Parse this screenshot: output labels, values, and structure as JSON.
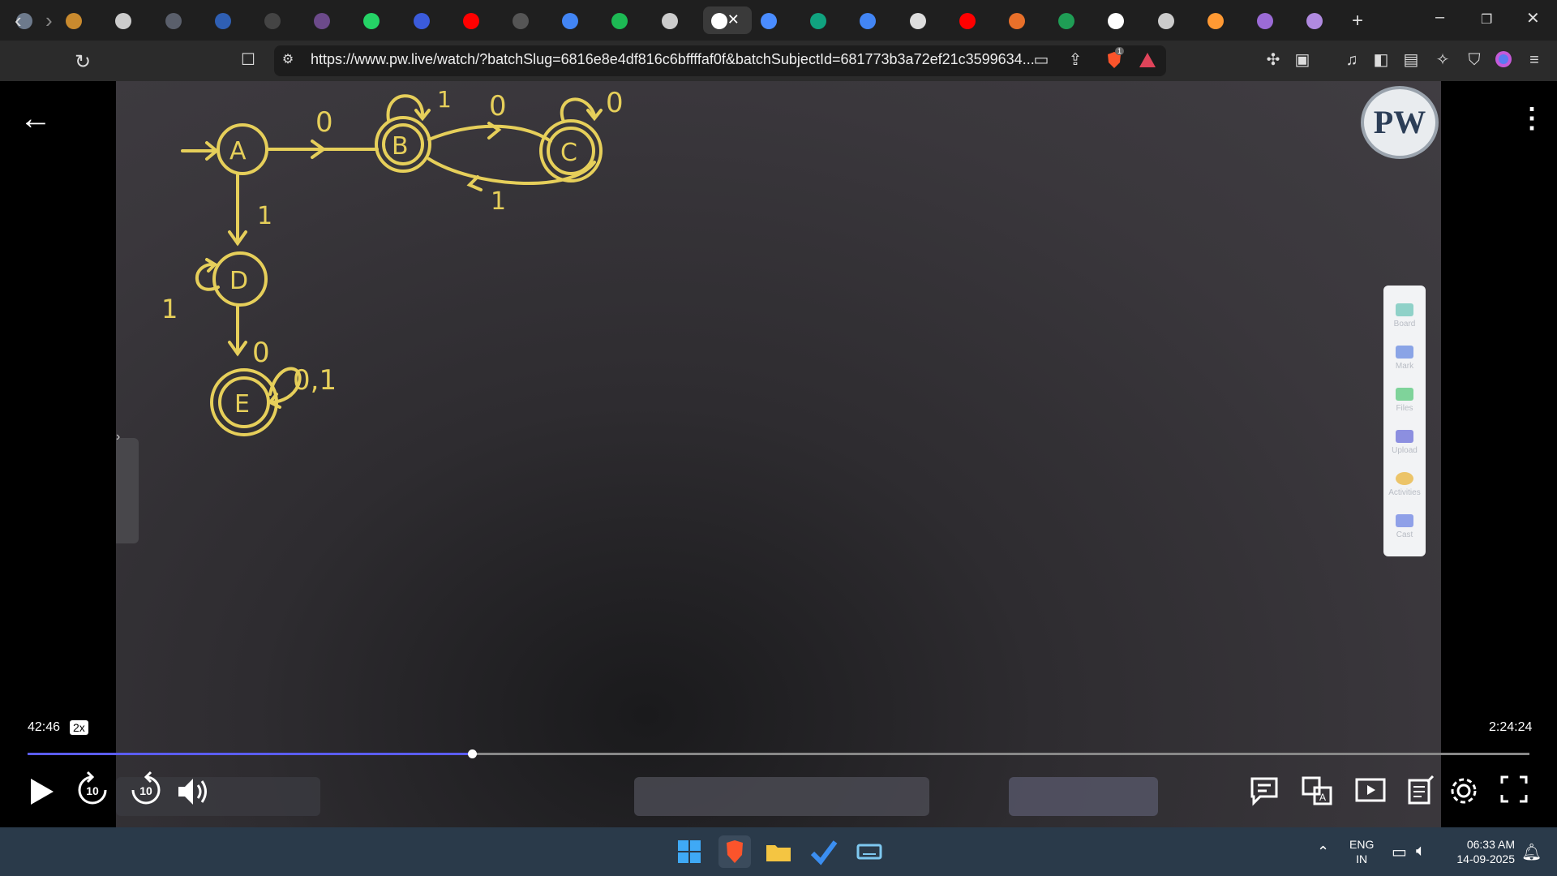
{
  "browser": {
    "tabs": [
      {
        "icon": "round-app-icon",
        "color": "#6d7a8c"
      },
      {
        "icon": "circle-s-icon",
        "color": "#c98a2e"
      },
      {
        "icon": "globe-icon",
        "color": "#cccccc"
      },
      {
        "icon": "m-logo-icon",
        "color": "#5a5f6b"
      },
      {
        "icon": "w-logo-icon",
        "color": "#2f5fb3"
      },
      {
        "icon": "gray-circle-icon",
        "color": "#444444"
      },
      {
        "icon": "purple-avatar-icon",
        "color": "#6c4a8a"
      },
      {
        "icon": "whatsapp-icon",
        "color": "#25d366"
      },
      {
        "icon": "bookmark-blue-icon",
        "color": "#3b5bdb"
      },
      {
        "icon": "youtube-icon",
        "color": "#ff0000"
      },
      {
        "icon": "gray-logo-icon",
        "color": "#555555"
      },
      {
        "icon": "google-icon",
        "color": "#4285f4"
      },
      {
        "icon": "spotify-icon",
        "color": "#1db954"
      },
      {
        "icon": "globe-icon",
        "color": "#cccccc"
      },
      {
        "icon": "active-tab-icon",
        "color": "#ffffff",
        "active": true
      },
      {
        "icon": "gemini-icon",
        "color": "#4a8cff"
      },
      {
        "icon": "chatgpt-icon",
        "color": "#10a37f"
      },
      {
        "icon": "google-icon",
        "color": "#4285f4"
      },
      {
        "icon": "square-icon",
        "color": "#dddddd"
      },
      {
        "icon": "youtube-icon",
        "color": "#ff0000"
      },
      {
        "icon": "orange-ball-icon",
        "color": "#e8702a"
      },
      {
        "icon": "green-chart-icon",
        "color": "#1f9d55"
      },
      {
        "icon": "wikipedia-icon",
        "color": "#ffffff"
      },
      {
        "icon": "globe-icon",
        "color": "#cccccc"
      },
      {
        "icon": "india-flag-icon",
        "color": "#ff9933"
      },
      {
        "icon": "purple-circle-icon",
        "color": "#9b6bd6"
      },
      {
        "icon": "purple-circle-icon",
        "color": "#b08ae0"
      }
    ],
    "url": "https://www.pw.live/watch/?batchSlug=6816e8e4df816c6bffffaf0f&batchSubjectId=681773b3a72ef21c3599634...",
    "brave_badge": "1"
  },
  "video": {
    "logo_text": "PW",
    "diagram": {
      "states": [
        "A",
        "B",
        "C",
        "D",
        "E"
      ],
      "labels": [
        "0",
        "1",
        "0",
        "0",
        "1",
        "1",
        "0",
        "0,1",
        "1"
      ]
    },
    "side_panel": [
      "Board",
      "Mark",
      "Files",
      "Upload",
      "Activities",
      "Cast"
    ]
  },
  "player": {
    "elapsed": "42:46",
    "speed": "2x",
    "duration": "2:24:24",
    "progress_fraction": 0.296,
    "rewind_label": "10",
    "forward_label": "10"
  },
  "taskbar": {
    "lang": "ENG",
    "region": "IN",
    "time": "06:33 AM",
    "date": "14-09-2025"
  }
}
